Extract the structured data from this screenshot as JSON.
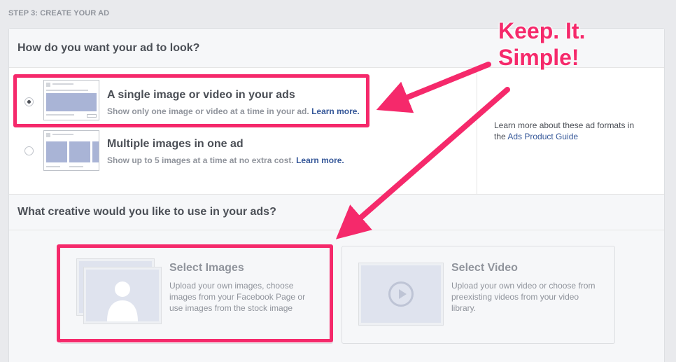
{
  "step_title": "STEP 3: CREATE YOUR AD",
  "format_section": {
    "title": "How do you want your ad to look?",
    "options": [
      {
        "title": "A single image or video in your ads",
        "description": "Show only one image or video at a time in your ad.",
        "link": "Learn more.",
        "selected": true
      },
      {
        "title": "Multiple images in one ad",
        "description": "Show up to 5 images at a time at no extra cost.",
        "link": "Learn more.",
        "selected": false
      }
    ],
    "info_text": "Learn more about these ad formats in the",
    "info_link": "Ads Product Guide"
  },
  "creative_section": {
    "title": "What creative would you like to use in your ads?",
    "cards": [
      {
        "title": "Select Images",
        "description": "Upload your own images, choose images from your Facebook Page or use images from the stock image",
        "icon": "image-stack-icon"
      },
      {
        "title": "Select Video",
        "description": "Upload your own video or choose from preexisting videos from your video library.",
        "icon": "video-play-icon"
      }
    ]
  },
  "annotation": {
    "callout_line1": "Keep. It.",
    "callout_line2": "Simple!",
    "color": "#f5296b"
  }
}
